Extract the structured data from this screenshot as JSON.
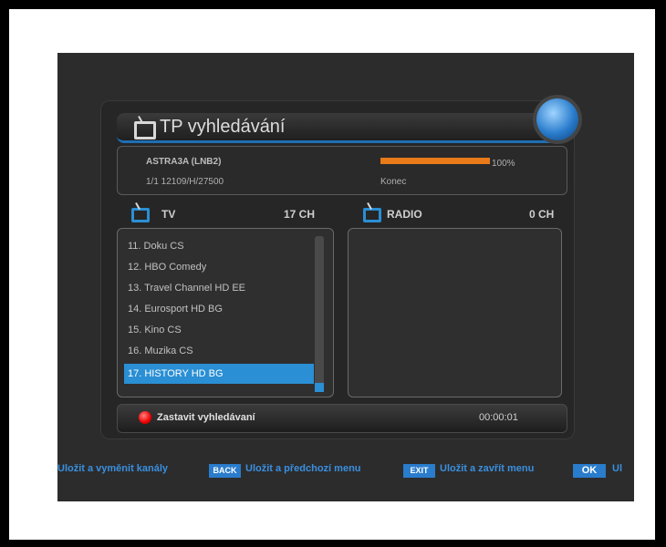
{
  "title": "TP vyhledávání",
  "info": {
    "satellite": "ASTRA3A (LNB2)",
    "transponder": "1/1 12109/H/27500",
    "progress_percent_label": "100%",
    "progress_fraction": 1.0,
    "status": "Konec"
  },
  "tv": {
    "label": "TV",
    "count": "17 CH"
  },
  "radio": {
    "label": "RADIO",
    "count": "0 CH"
  },
  "channels": [
    "11. Doku CS",
    "12. HBO Comedy",
    "13. Travel Channel HD EE",
    "14. Eurosport HD BG",
    "15. Kino CS",
    "16. Muzika CS",
    "17. HISTORY HD BG"
  ],
  "action": {
    "label": "Zastavit vyhledávaní",
    "time": "00:00:01"
  },
  "bottom": {
    "save_replace": "Uložit a vyměnit kanály",
    "back_key": "BACK",
    "save_prev": "Uložit a předchozí menu",
    "exit_key": "EXIT",
    "save_close": "Uložit a zavřít menu",
    "ok_key": "OK",
    "ok_tail": "Ul"
  }
}
